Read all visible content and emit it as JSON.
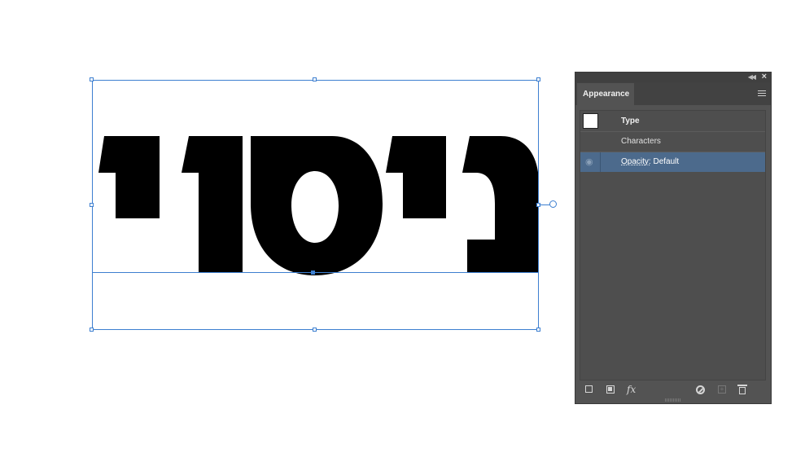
{
  "canvas": {
    "text_content": "ניסוי",
    "text_color": "#000000",
    "selection_color": "#3d7fd0"
  },
  "panel": {
    "tab_label": "Appearance",
    "collapse_icon": "double-chevron-left-icon",
    "close_icon": "close-icon",
    "menu_icon": "hamburger-menu-icon",
    "rows": {
      "type_label": "Type",
      "characters_label": "Characters",
      "opacity_link": "Opacity:",
      "opacity_value": "Default"
    },
    "bottom_icons": [
      "add-stroke-icon",
      "add-fill-icon",
      "fx-icon",
      "clear-appearance-icon",
      "duplicate-item-icon",
      "delete-icon"
    ],
    "fx_label": "fx",
    "colors": {
      "panel_bg": "#535353",
      "selected_row": "#4c6a8c"
    }
  }
}
